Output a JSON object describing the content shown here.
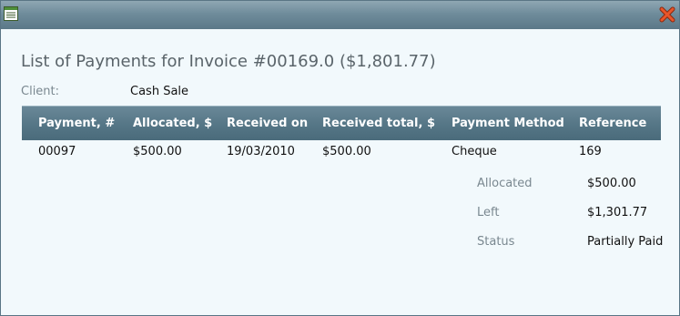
{
  "window": {
    "icon": "document-list-icon",
    "close_icon": "close-x-icon",
    "colors": {
      "titlebar": "#6f8c9b",
      "body": "#f2f9fc",
      "grid_header": "#557686",
      "close": "#d9471f"
    }
  },
  "heading": "List of Payments for Invoice #00169.0 ($1,801.77)",
  "client": {
    "label": "Client:",
    "value": "Cash Sale"
  },
  "table": {
    "columns": [
      "Payment, #",
      "Allocated, $",
      "Received on",
      "Received total, $",
      "Payment Method",
      "Reference"
    ],
    "rows": [
      {
        "payment": "00097",
        "allocated": "$500.00",
        "received_on": "19/03/2010",
        "received_total": "$500.00",
        "method": "Cheque",
        "reference": "169"
      }
    ]
  },
  "summary": [
    {
      "label": "Allocated",
      "value": "$500.00"
    },
    {
      "label": "Left",
      "value": "$1,301.77"
    },
    {
      "label": "Status",
      "value": "Partially Paid"
    }
  ]
}
